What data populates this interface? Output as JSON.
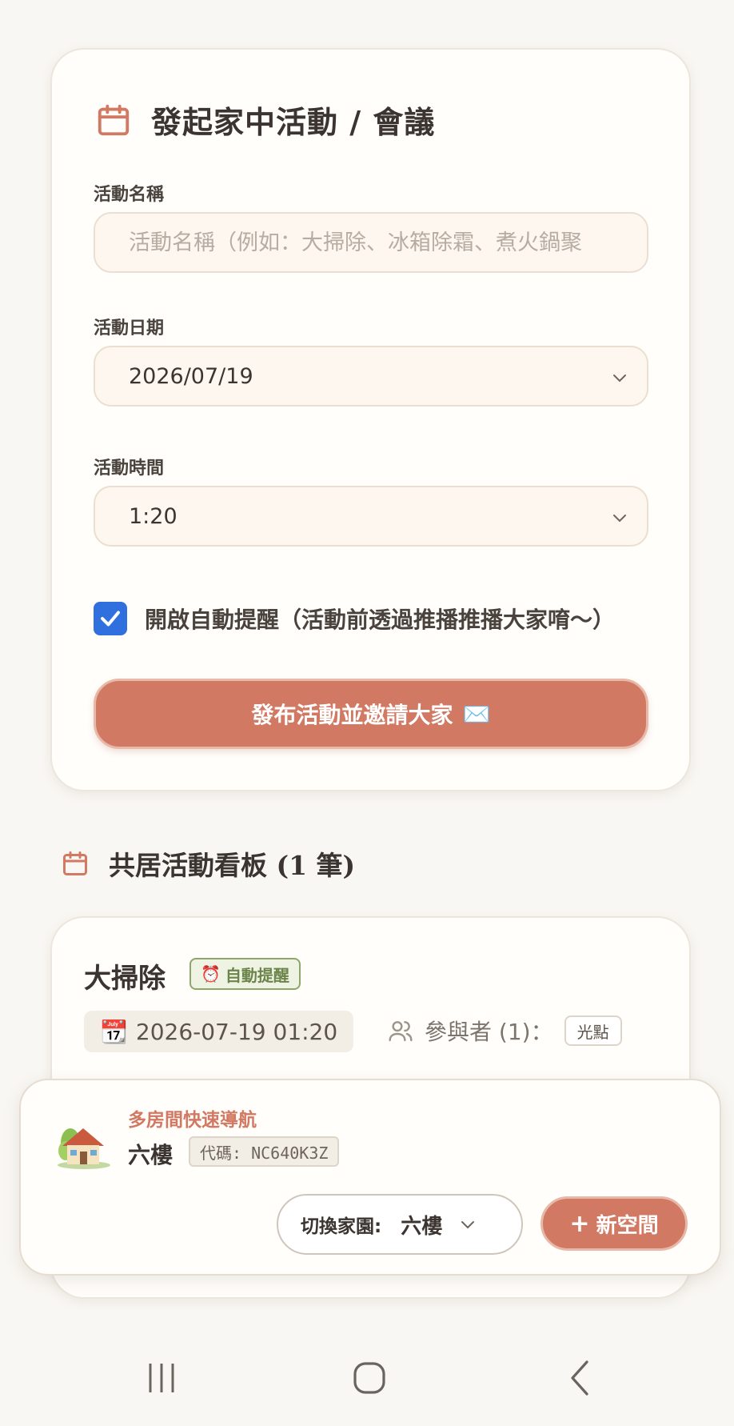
{
  "form": {
    "title": "發起家中活動 / 會議",
    "name_label": "活動名稱",
    "name_placeholder": "活動名稱（例如：大掃除、冰箱除霜、煮火鍋聚",
    "date_label": "活動日期",
    "date_value": "2026/07/19",
    "time_label": "活動時間",
    "time_value": "1:20",
    "reminder_label": "開啟自動提醒（活動前透過推播推播大家唷～）",
    "reminder_checked": true,
    "submit_label": "發布活動並邀請大家",
    "submit_icon": "✉️"
  },
  "board": {
    "title": "共居活動看板 (1 筆)"
  },
  "event": {
    "name": "大掃除",
    "badge": "自動提醒",
    "badge_icon": "⏰",
    "date_icon": "📆",
    "datetime": "2026-07-19 01:20",
    "participants_label": "參與者 (1)：",
    "participant": "光點"
  },
  "nav": {
    "subtitle": "多房間快速導航",
    "space_name": "六樓",
    "code": "代碼: NC640K3Z",
    "switch_label": "切換家園:",
    "switch_value": "六樓",
    "new_space_label": "新空間"
  },
  "colors": {
    "accent": "#d27963",
    "background": "#f9f7f3",
    "checkbox": "#2f6fde",
    "badge_green": "#6b8449"
  }
}
